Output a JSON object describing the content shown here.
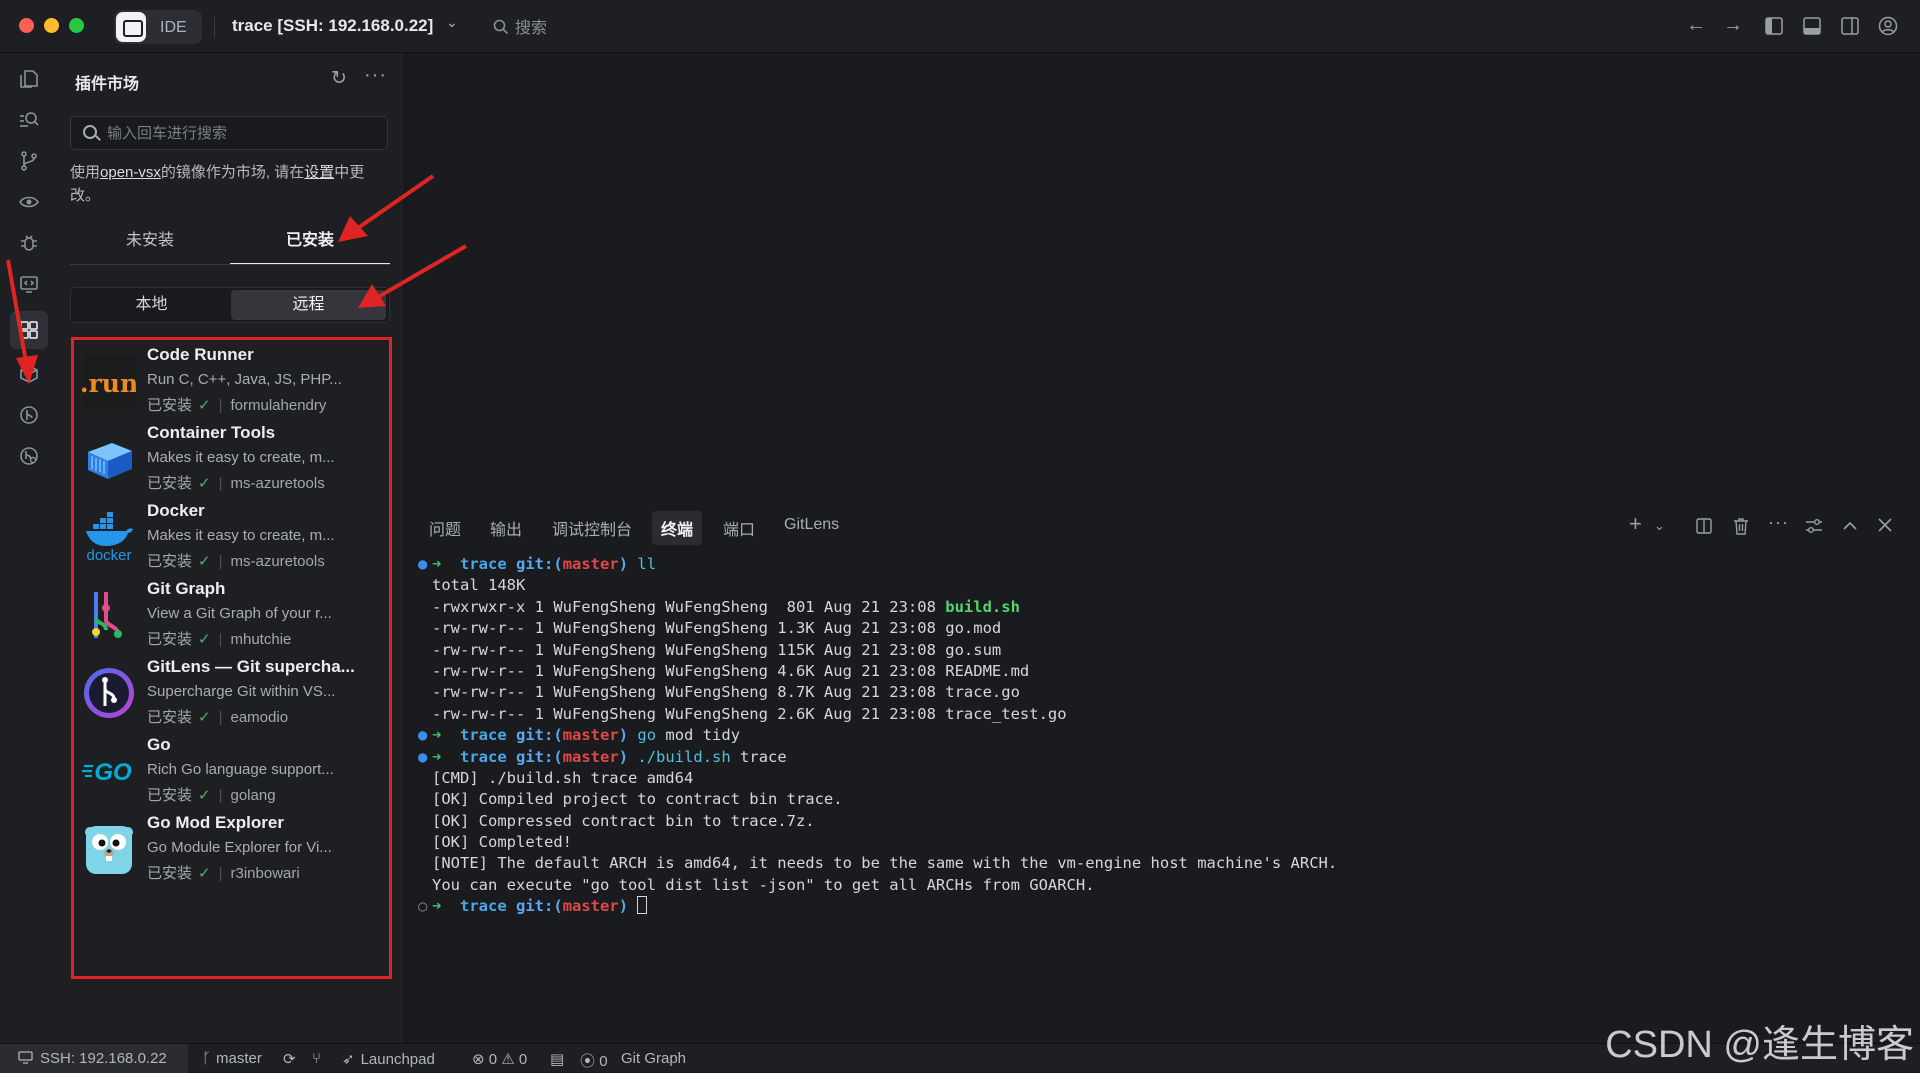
{
  "titlebar": {
    "app_label": "IDE",
    "workspace_title": "trace [SSH: 192.168.0.22]",
    "search_placeholder": "搜索"
  },
  "sidebar": {
    "title": "插件市场",
    "search_placeholder": "输入回车进行搜索",
    "notice_prefix": "使用",
    "notice_link1": "open-vsx",
    "notice_middle": "的镜像作为市场, 请在",
    "notice_link2": "设置",
    "notice_suffix": "中更改。",
    "tabs": [
      {
        "label": "未安装"
      },
      {
        "label": "已安装"
      }
    ],
    "subtabs": [
      {
        "label": "本地"
      },
      {
        "label": "远程"
      }
    ],
    "extensions": [
      {
        "name": "Code Runner",
        "desc": "Run C, C++, Java, JS, PHP...",
        "status": "已安装",
        "check": "✓",
        "publisher": "formulahendry",
        "icon": "run-logo-icon"
      },
      {
        "name": "Container Tools",
        "desc": "Makes it easy to create, m...",
        "status": "已安装",
        "check": "✓",
        "publisher": "ms-azuretools",
        "icon": "container-box-icon"
      },
      {
        "name": "Docker",
        "desc": "Makes it easy to create, m...",
        "status": "已安装",
        "check": "✓",
        "publisher": "ms-azuretools",
        "icon": "docker-whale-icon",
        "logo_text": "docker"
      },
      {
        "name": "Git Graph",
        "desc": "View a Git Graph of your r...",
        "status": "已安装",
        "check": "✓",
        "publisher": "mhutchie",
        "icon": "git-graph-icon"
      },
      {
        "name": "GitLens — Git supercha...",
        "desc": "Supercharge Git within VS...",
        "status": "已安装",
        "check": "✓",
        "publisher": "eamodio",
        "icon": "gitlens-icon"
      },
      {
        "name": "Go",
        "desc": "Rich Go language support...",
        "status": "已安装",
        "check": "✓",
        "publisher": "golang",
        "icon": "go-logo-icon",
        "logo_text": "GO"
      },
      {
        "name": "Go Mod Explorer",
        "desc": "Go Module Explorer for Vi...",
        "status": "已安装",
        "check": "✓",
        "publisher": "r3inbowari",
        "icon": "gopher-icon"
      }
    ]
  },
  "panel": {
    "tabs": [
      {
        "label": "问题"
      },
      {
        "label": "输出"
      },
      {
        "label": "调试控制台"
      },
      {
        "label": "终端"
      },
      {
        "label": "端口"
      },
      {
        "label": "GitLens"
      }
    ]
  },
  "terminal": {
    "prompt_dir": "trace",
    "prompt_git": "git:(",
    "prompt_branch": "master",
    "prompt_close": ")",
    "cmd1": "ll",
    "total": "total 148K",
    "files": [
      {
        "prefix": "-rwxrwxr-x 1 WuFengSheng WuFengSheng  801 Aug 21 23:08 ",
        "name": "build.sh",
        "exec": true
      },
      {
        "prefix": "-rw-rw-r-- 1 WuFengSheng WuFengSheng 1.3K Aug 21 23:08 ",
        "name": "go.mod",
        "exec": false
      },
      {
        "prefix": "-rw-rw-r-- 1 WuFengSheng WuFengSheng 115K Aug 21 23:08 ",
        "name": "go.sum",
        "exec": false
      },
      {
        "prefix": "-rw-rw-r-- 1 WuFengSheng WuFengSheng 4.6K Aug 21 23:08 ",
        "name": "README.md",
        "exec": false
      },
      {
        "prefix": "-rw-rw-r-- 1 WuFengSheng WuFengSheng 8.7K Aug 21 23:08 ",
        "name": "trace.go",
        "exec": false
      },
      {
        "prefix": "-rw-rw-r-- 1 WuFengSheng WuFengSheng 2.6K Aug 21 23:08 ",
        "name": "trace_test.go",
        "exec": false
      }
    ],
    "cmd2_word": "go",
    "cmd2_rest": " mod tidy",
    "cmd3_word": "./build.sh",
    "cmd3_rest": " trace",
    "output": [
      "[CMD] ./build.sh trace amd64",
      "[OK] Compiled project to contract bin trace.",
      "[OK] Compressed contract bin to trace.7z.",
      "[OK] Completed!",
      "[NOTE] The default ARCH is amd64, it needs to be the same with the vm-engine host machine's ARCH.",
      "You can execute \"go tool dist list -json\" to get all ARCHs from GOARCH."
    ]
  },
  "statusbar": {
    "remote": "SSH: 192.168.0.22",
    "branch": "master",
    "launchpad": "Launchpad",
    "errors": "0",
    "warnings": "0",
    "ports": "0",
    "gitgraph": "Git Graph"
  },
  "watermark": "CSDN @逢生博客",
  "colors": {
    "accent_red": "#e02424",
    "check_green": "#4fb36b"
  }
}
